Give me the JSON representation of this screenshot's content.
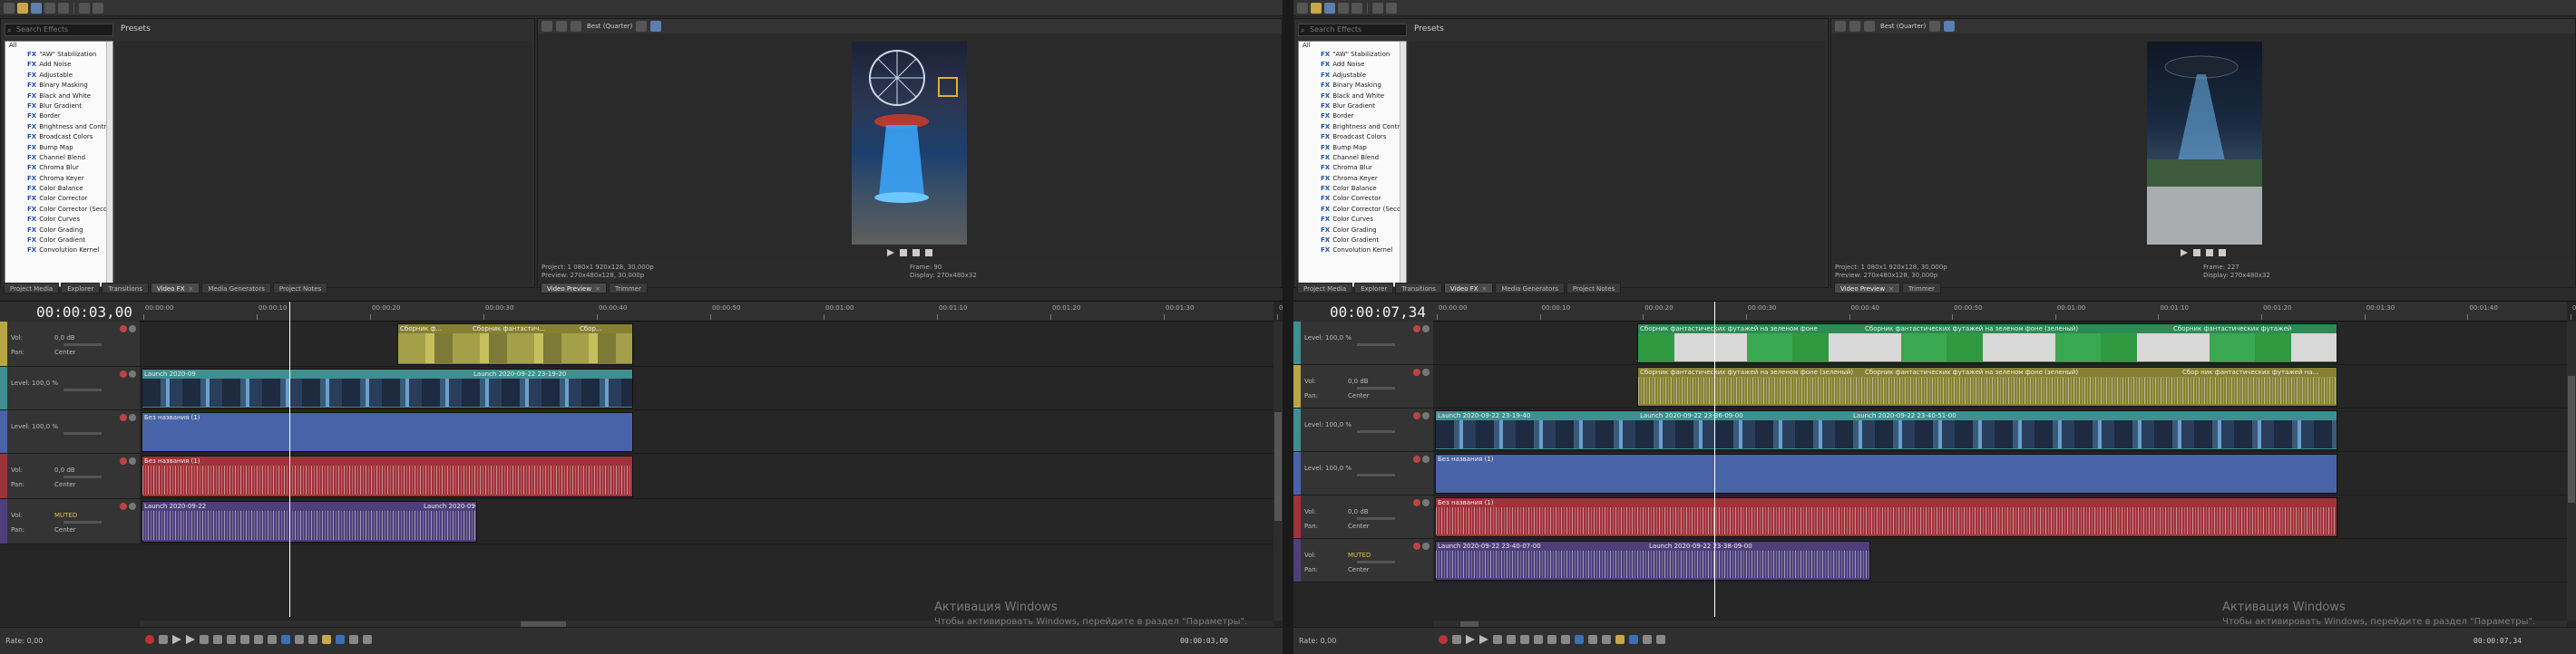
{
  "left": {
    "fx_search_placeholder": "Search Effects",
    "fx_panel_title": "Presets",
    "fx_root": "All",
    "fx_items": [
      "\"AW\" Stabilization",
      "Add Noise",
      "Adjustable",
      "Binary Masking",
      "Black and White",
      "Blur Gradient",
      "Border",
      "Brightness and Contrast",
      "Broadcast Colors",
      "Bump Map",
      "Channel Blend",
      "Chroma Blur",
      "Chroma Keyer",
      "Color Balance",
      "Color Corrector",
      "Color Corrector (Secondary)",
      "Color Curves",
      "Color Grading",
      "Color Gradient",
      "Convolution Kernel"
    ],
    "tabs": [
      "Project Media",
      "Explorer",
      "Transitions",
      "Video FX",
      "Media Generators",
      "Project Notes"
    ],
    "lower_tabs": [
      "Video Preview",
      "Trimmer"
    ],
    "preview_label": "Best (Quarter)",
    "preview_info_1": "Project: 1 080x1 920x128, 30,000p",
    "preview_info_2": "Preview: 270x480x128, 30,000p",
    "preview_info_3": "Frame: 90",
    "preview_info_4": "Display: 270x480x32",
    "timecode": "00:00:03,00",
    "footer_tc": "00:00:03,00",
    "rate": "Rate: 0,00",
    "ruler": [
      "00:00:00",
      "00:00:10",
      "00:00:20",
      "00:00:30",
      "00:00:40",
      "00:00:50",
      "00:01:00",
      "00:01:10",
      "00:01:20",
      "00:01:30",
      "00:01:40"
    ],
    "tracks": [
      {
        "label1": "Vol:",
        "val1": "0,0 dB",
        "label2": "Pan:",
        "val2": "Center",
        "color": "#b8a640"
      },
      {
        "label1": "Level: 100,0 %",
        "val1": "",
        "label2": "",
        "val2": "",
        "color": "#3f8f90"
      },
      {
        "label1": "Level: 100,0 %",
        "val1": "",
        "label2": "",
        "val2": "",
        "color": "#4863a8"
      },
      {
        "label1": "Vol:",
        "val1": "0,0 dB",
        "label2": "Pan:",
        "val2": "Center",
        "color": "#a0323a"
      },
      {
        "label1": "Vol:",
        "val1": "MUTED",
        "label2": "Pan:",
        "val2": "Center",
        "color": "#4e3f7a"
      }
    ],
    "clips": {
      "olive_a": "Сборник ф...",
      "olive_b": "Сборник фантастич...",
      "olive_c": "Сбор...",
      "video_a": "Launch 2020-09",
      "video_b": "Launch 2020-09-22 23-19-20",
      "blue_a": "Без названия (1)",
      "red_a": "Без названия (1)",
      "purple_a": "Launch 2020-09-22",
      "purple_b": "Launch 2020-09-..."
    },
    "watermark_1": "Активация Windows",
    "watermark_2": "Чтобы активировать Windows, перейдите в раздел \"Параметры\"."
  },
  "right": {
    "fx_search_placeholder": "Search Effects",
    "fx_panel_title": "Presets",
    "fx_root": "All",
    "fx_items": [
      "\"AW\" Stabilization",
      "Add Noise",
      "Adjustable",
      "Binary Masking",
      "Black and White",
      "Blur Gradient",
      "Border",
      "Brightness and Contrast",
      "Broadcast Colors",
      "Bump Map",
      "Channel Blend",
      "Chroma Blur",
      "Chroma Keyer",
      "Color Balance",
      "Color Corrector",
      "Color Corrector (Secondary)",
      "Color Curves",
      "Color Grading",
      "Color Gradient",
      "Convolution Kernel"
    ],
    "tabs": [
      "Project Media",
      "Explorer",
      "Transitions",
      "Video FX",
      "Media Generators",
      "Project Notes"
    ],
    "lower_tabs": [
      "Video Preview",
      "Trimmer"
    ],
    "preview_label": "Best (Quarter)",
    "preview_info_1": "Project: 1 080x1 920x128, 30,000p",
    "preview_info_2": "Preview: 270x480x128, 30,000p",
    "preview_info_3": "Frame: 227",
    "preview_info_4": "Display: 270x480x32",
    "timecode": "00:00:07,34",
    "footer_tc": "00:00:07,34",
    "rate": "Rate: 0,00",
    "ruler": [
      "00:00:00",
      "00:00:10",
      "00:00:20",
      "00:00:30",
      "00:00:40",
      "00:00:50",
      "00:01:00",
      "00:01:10",
      "00:01:20",
      "00:01:30",
      "00:01:40",
      "00:01:50"
    ],
    "tracks": [
      {
        "label1": "Level: 100,0 %",
        "val1": "",
        "label2": "",
        "val2": "",
        "color": "#3f8f90"
      },
      {
        "label1": "Vol:",
        "val1": "0,0 dB",
        "label2": "Pan:",
        "val2": "Center",
        "color": "#b8a640"
      },
      {
        "label1": "Level: 100,0 %",
        "val1": "",
        "label2": "",
        "val2": "",
        "color": "#3f8f90"
      },
      {
        "label1": "Level: 100,0 %",
        "val1": "",
        "label2": "",
        "val2": "",
        "color": "#4863a8"
      },
      {
        "label1": "Vol:",
        "val1": "0,0 dB",
        "label2": "Pan:",
        "val2": "Center",
        "color": "#a0323a"
      },
      {
        "label1": "Vol:",
        "val1": "MUTED",
        "label2": "Pan:",
        "val2": "Center",
        "color": "#4e3f7a"
      }
    ],
    "clips": {
      "video_a": "Сборник фантастических футажей на зеленом фоне",
      "video_b": "Сборник фантастических футажей на зеленом фоне (зеленый)",
      "video_c": "Сборник фантастических футажей",
      "olive_a": "Сборник фантастических футажей на зеленом фоне (зеленый)",
      "olive_b": "Сборник фантастических футажей на зеленом фоне (зеленый)",
      "olive_c": "Сбор ник фантастических футажей на...",
      "video_d": "Launch 2020-09-22 23-19-40",
      "video_e": "Launch 2020-09-22 23-36-09-00",
      "video_f": "Launch 2020-09-22 23-40-51-00",
      "blue_a": "Без названия (1)",
      "red_a": "Без названия (1)",
      "purple_a": "Launch 2020-09-22 23-40-07-00",
      "purple_b": "Launch 2020-09-22 23-38-09-00"
    },
    "watermark_1": "Активация Windows",
    "watermark_2": "Чтобы активировать Windows, перейдите в раздел \"Параметры\"."
  }
}
